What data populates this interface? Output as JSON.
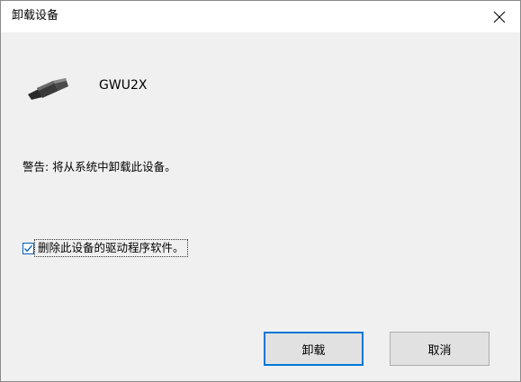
{
  "dialog": {
    "title": "卸载设备",
    "close_icon": "close-icon"
  },
  "device": {
    "icon": "usb-plug-icon",
    "name": "GWU2X"
  },
  "warning": {
    "text": "警告: 将从系统中卸载此设备。"
  },
  "option": {
    "checked": true,
    "label": "删除此设备的驱动程序软件。"
  },
  "buttons": {
    "uninstall_label": "卸载",
    "cancel_label": "取消"
  },
  "colors": {
    "accent": "#0078d7",
    "dialog_background": "#f0f0f0",
    "titlebar_background": "#ffffff",
    "button_background": "#e1e1e1"
  }
}
